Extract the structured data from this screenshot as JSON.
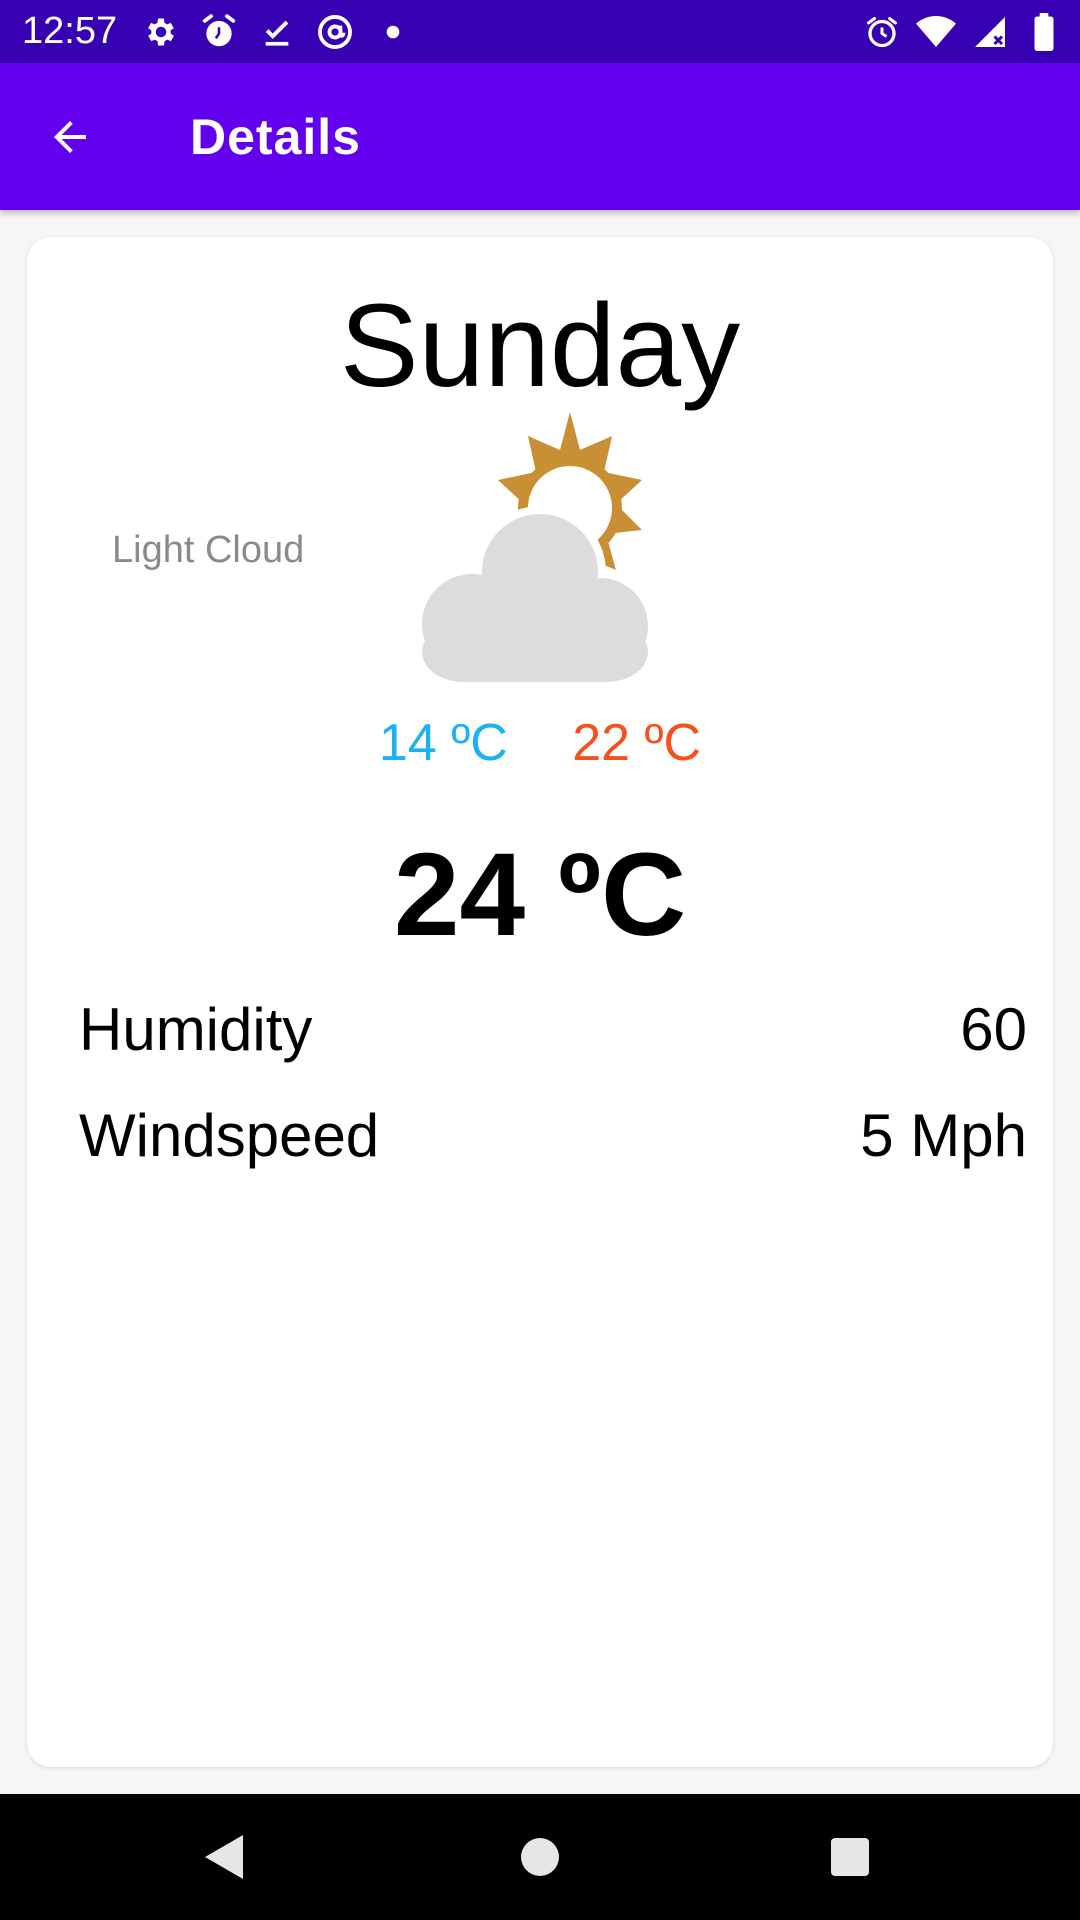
{
  "status_bar": {
    "time": "12:57",
    "left_icons": [
      "settings-icon",
      "alarm-clock-icon",
      "download-done-icon",
      "at-sign-icon",
      "dot-icon"
    ],
    "right_icons": [
      "alarm-icon",
      "wifi-icon",
      "signal-icon",
      "battery-icon"
    ]
  },
  "app_bar": {
    "title": "Details",
    "back_icon": "arrow-left-icon",
    "color": "#6200ee"
  },
  "details": {
    "day": "Sunday",
    "condition": "Light Cloud",
    "condition_icon": "sun-behind-cloud-icon",
    "min_temp": "14 ºC",
    "max_temp": "22 ºC",
    "current_temp": "24 ºC",
    "stats": [
      {
        "label": "Humidity",
        "value": "60"
      },
      {
        "label": "Windspeed",
        "value": "5 Mph"
      }
    ]
  },
  "colors": {
    "status_bar": "#3700b3",
    "app_bar": "#6200ee",
    "min_temp": "#1ab3f0",
    "max_temp": "#f4511e",
    "sun": "#c98f35",
    "cloud": "#dcdcdc"
  },
  "nav_bar": {
    "buttons": [
      "back-triangle-icon",
      "home-circle-icon",
      "recents-square-icon"
    ]
  }
}
